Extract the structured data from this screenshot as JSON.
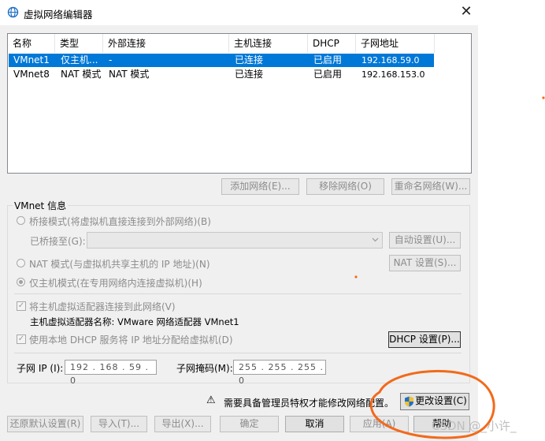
{
  "window": {
    "title": "虚拟网络编辑器",
    "close_symbol": "✕"
  },
  "table": {
    "headers": [
      "名称",
      "类型",
      "外部连接",
      "主机连接",
      "DHCP",
      "子网地址"
    ],
    "rows": [
      {
        "name": "VMnet1",
        "type": "仅主机...",
        "external": "-",
        "host": "已连接",
        "dhcp": "已启用",
        "subnet": "192.168.59.0",
        "selected": true
      },
      {
        "name": "VMnet8",
        "type": "NAT 模式",
        "external": "NAT 模式",
        "host": "已连接",
        "dhcp": "已启用",
        "subnet": "192.168.153.0",
        "selected": false
      }
    ]
  },
  "table_buttons": {
    "add": "添加网络(E)...",
    "remove": "移除网络(O)",
    "rename": "重命名网络(W)..."
  },
  "vmnet_info": {
    "legend": "VMnet 信息",
    "bridged_label": "桥接模式(将虚拟机直接连接到外部网络)(B)",
    "bridged_to_label": "已桥接至(G):",
    "auto_settings": "自动设置(U)...",
    "nat_label": "NAT 模式(与虚拟机共享主机的 IP 地址)(N)",
    "nat_settings": "NAT 设置(S)...",
    "host_only_label": "仅主机模式(在专用网络内连接虚拟机)(H)",
    "connect_adapter_label": "将主机虚拟适配器连接到此网络(V)",
    "adapter_name_label": "主机虚拟适配器名称: VMware 网络适配器 VMnet1",
    "dhcp_label": "使用本地 DHCP 服务将 IP 地址分配给虚拟机(D)",
    "dhcp_settings": "DHCP 设置(P)...",
    "subnet_ip_label": "子网 IP (I):",
    "subnet_ip": "192 . 168 . 59 . 0",
    "subnet_mask_label": "子网掩码(M):",
    "subnet_mask": "255 . 255 . 255 . 0"
  },
  "admin": {
    "notice": "需要具备管理员特权才能修改网络配置。",
    "change_settings": "更改设置(C)",
    "warning_symbol": "⚠"
  },
  "footer": {
    "restore": "还原默认设置(R)",
    "import": "导入(T)...",
    "export": "导出(X)...",
    "ok": "确定",
    "cancel": "取消",
    "apply": "应用(A)",
    "help": "帮助"
  },
  "watermark": "CSDN @_小许_",
  "colors": {
    "selection": "#0078d7",
    "annotation": "#f26a1b",
    "disabled_text": "#8c8c8c"
  }
}
